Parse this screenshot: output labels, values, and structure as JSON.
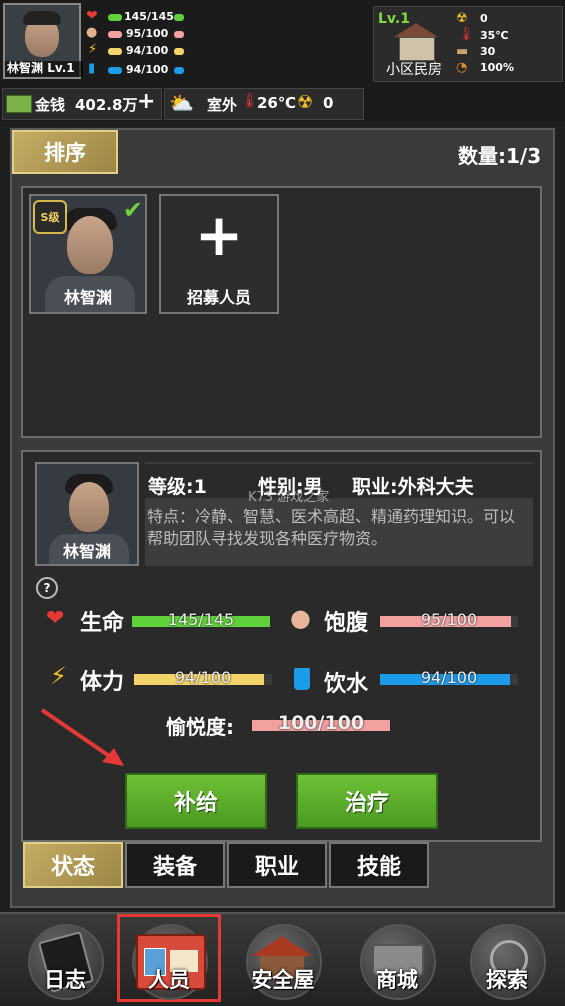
{
  "player": {
    "name": "林智渊",
    "level": "Lv.1",
    "hp": "145/145",
    "hunger": "95/100",
    "stamina": "94/100",
    "water": "94/100"
  },
  "location": {
    "level": "Lv.1",
    "name": "小区民房",
    "radiation": "0",
    "temperature": "35℃",
    "materials": "30",
    "durability": "100%"
  },
  "resources": {
    "money_label": "金钱",
    "money_value": "402.8万",
    "plus": "+",
    "environment": "室外",
    "env_temp": "26℃",
    "env_radiation": "0"
  },
  "toolbar": {
    "sort_label": "排序",
    "count_label": "数量:1/3"
  },
  "roster": {
    "member_name": "林智渊",
    "member_rank": "S级",
    "recruit_label": "招募人员",
    "recruit_plus": "+"
  },
  "detail": {
    "name": "林智渊",
    "level": "等级:1",
    "gender": "性别:男",
    "job": "职业:外科大夫",
    "trait": "特点：冷静、智慧、医术高超、精通药理知识。可以帮助团队寻找发现各种医疗物资。",
    "help": "?",
    "watermark": "K73 游戏之家"
  },
  "stats": {
    "hp_label": "生命",
    "hp_value": "145/145",
    "hp_ratio": 1.0,
    "hunger_label": "饱腹",
    "hunger_value": "95/100",
    "hunger_ratio": 0.95,
    "stamina_label": "体力",
    "stamina_value": "94/100",
    "stamina_ratio": 0.94,
    "water_label": "饮水",
    "water_value": "94/100",
    "water_ratio": 0.94,
    "joy_label": "愉悦度:",
    "joy_value": "100/100",
    "joy_ratio": 1.0
  },
  "actions": {
    "supply": "补给",
    "treat": "治疗"
  },
  "tabs": [
    "状态",
    "装备",
    "职业",
    "技能"
  ],
  "nav": [
    "日志",
    "人员",
    "安全屋",
    "商城",
    "探索"
  ],
  "colors": {
    "hp": "#5fd13b",
    "hunger": "#f2a0a0",
    "stamina": "#f3d36a",
    "water": "#1e9be8",
    "accent_gold": "#b8a050",
    "button_green": "#5bb12c",
    "nav_highlight": "#e53935"
  }
}
